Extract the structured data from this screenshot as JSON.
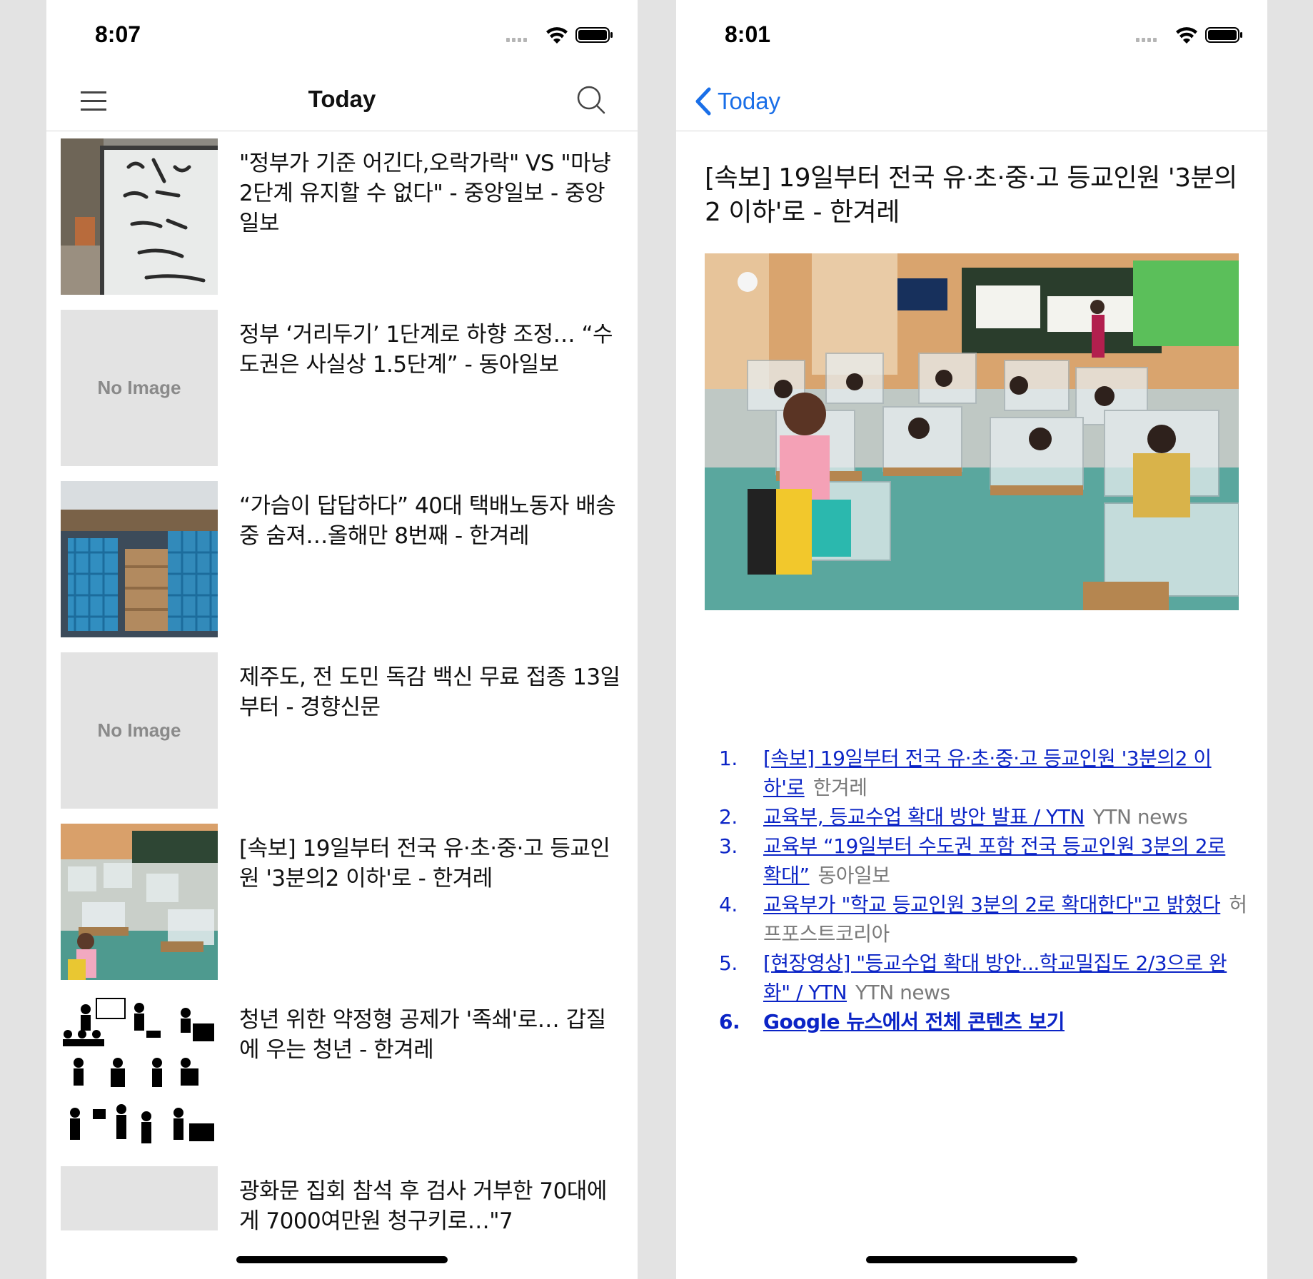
{
  "left_screen": {
    "status_time": "8:07",
    "nav_title": "Today",
    "news_items": [
      {
        "headline": "\"정부가 기준 어긴다,오락가락\" VS \"마냥 2단계 유지할 수 없다\" - 중앙일보 - 중앙일보",
        "thumbnail": "photo"
      },
      {
        "headline": "정부 ‘거리두기’ 1단계로 하향 조정… “수도권은 사실상 1.5단계” - 동아일보",
        "thumbnail": "none",
        "no_image_label": "No Image"
      },
      {
        "headline": "“가슴이 답답하다” 40대 택배노동자 배송중 숨져…올해만 8번째 - 한겨레",
        "thumbnail": "photo"
      },
      {
        "headline": "제주도, 전 도민 독감 백신 무료 접종 13일부터 - 경향신문",
        "thumbnail": "none",
        "no_image_label": "No Image"
      },
      {
        "headline": "[속보] 19일부터 전국 유·초·중·고 등교인원 '3분의2 이하'로 - 한겨레",
        "thumbnail": "photo"
      },
      {
        "headline": "청년 위한 약정형 공제가 '족쇄'로… 갑질에 우는 청년 - 한겨레",
        "thumbnail": "pictograms"
      },
      {
        "headline": "광화문 집회 참석 후 검사 거부한 70대에게 7000여만원 청구키로…\"7",
        "thumbnail": "blank"
      }
    ]
  },
  "right_screen": {
    "status_time": "8:01",
    "back_label": "Today",
    "article_title": "[속보] 19일부터 전국 유·초·중·고 등교인원 '3분의2 이하'로 - 한겨레",
    "related": [
      {
        "num": "1.",
        "link": "[속보] 19일부터 전국 유·초·중·고 등교인원 '3분의2 이하'로",
        "source": "한겨레"
      },
      {
        "num": "2.",
        "link": "교육부, 등교수업 확대 방안 발표 / YTN",
        "source": "YTN news"
      },
      {
        "num": "3.",
        "link": "교육부 “19일부터 수도권 포함 전국 등교인원 3분의 2로 확대”",
        "source": "동아일보"
      },
      {
        "num": "4.",
        "link": "교육부가 \"학교 등교인원 3분의 2로 확대한다\"고 밝혔다",
        "source": "허프포스트코리아"
      },
      {
        "num": "5.",
        "link": "[현장영상] \"등교수업 확대 방안...학교밀집도 2/3으로 완화\" / YTN",
        "source": "YTN news"
      },
      {
        "num": "6.",
        "link": "Google 뉴스에서 전체 콘텐츠 보기",
        "source": ""
      }
    ]
  },
  "icons": {
    "menu": "hamburger-icon",
    "search": "search-icon",
    "back": "chevron-left-icon",
    "signal": "cellular-signal-icon",
    "wifi": "wifi-icon",
    "battery": "battery-icon"
  },
  "colors": {
    "accent": "#1a6fe8",
    "link": "#0b24c6",
    "source": "#7a7a7a",
    "placeholder_bg": "#e3e3e3"
  }
}
